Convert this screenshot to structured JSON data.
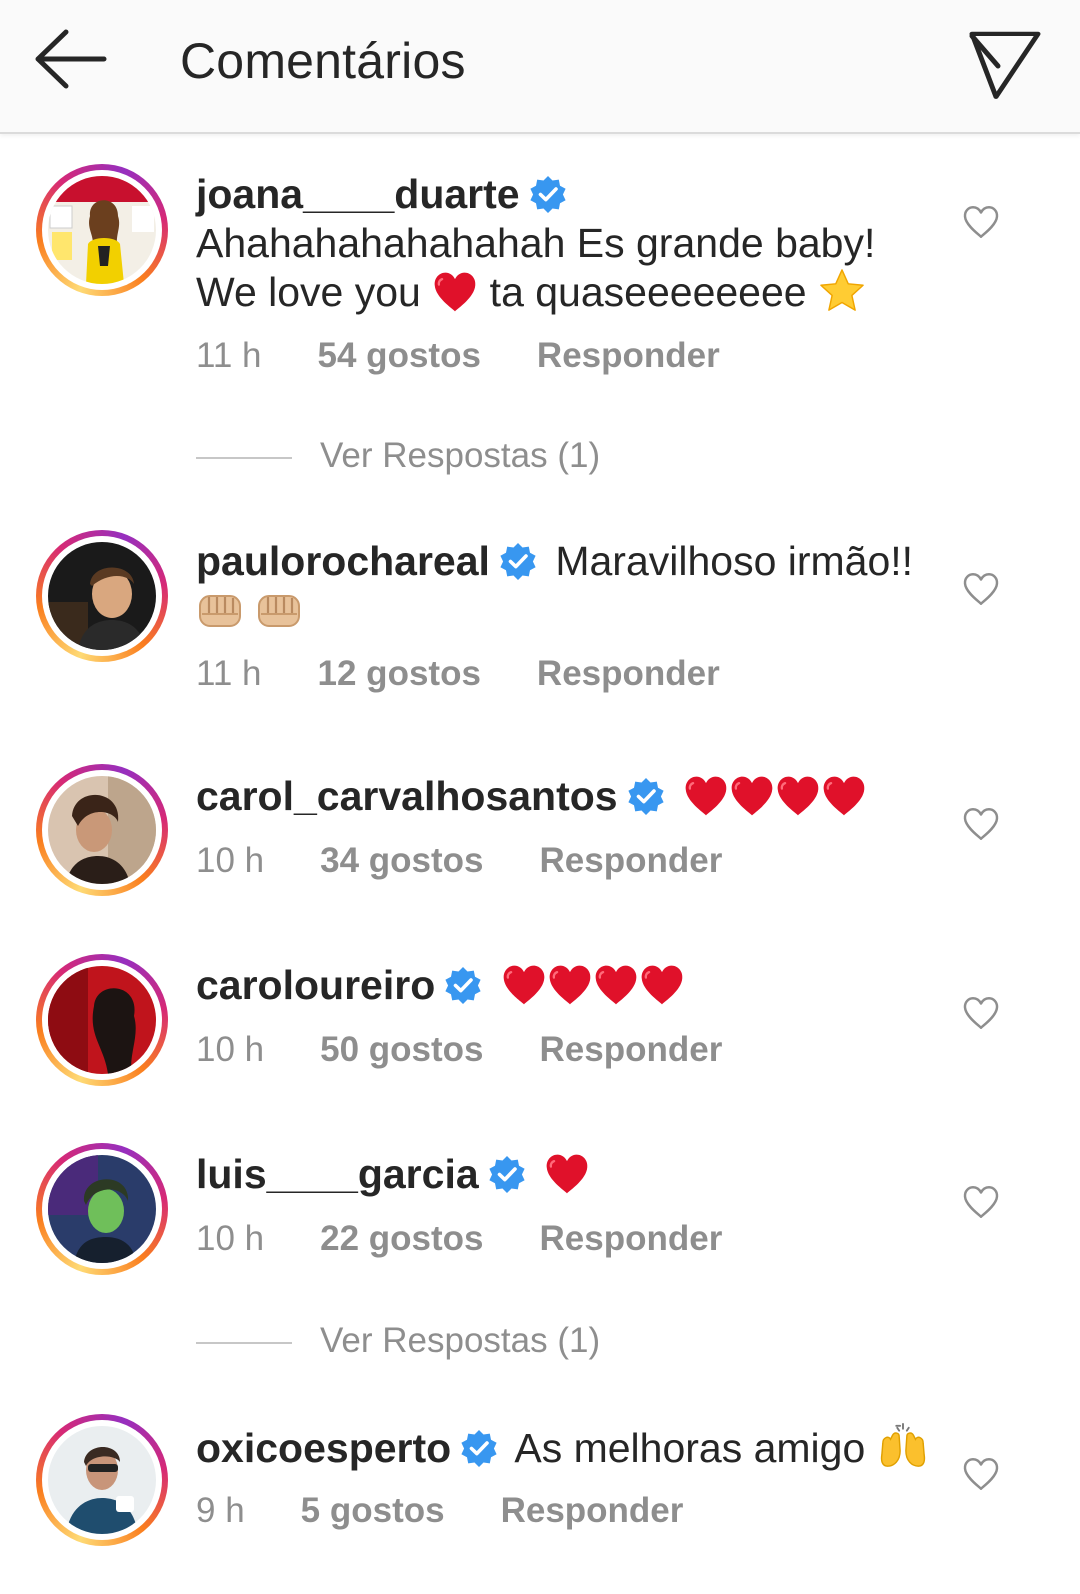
{
  "header": {
    "title": "Comentários",
    "back_icon": "arrow-left-icon",
    "share_icon": "paper-plane-icon"
  },
  "accent": {
    "heart": "#e0112a",
    "verified": "#3897f0",
    "meta_gray": "#8e8e8e"
  },
  "comments": [
    {
      "username": "joana____duarte",
      "verified": true,
      "text_1": "Ahahahahahahahah Es grande baby! We love you",
      "text_2": "ta quaseeeeeeee",
      "emoji": [
        "red-heart",
        "star"
      ],
      "time": "11 h",
      "likes": "54 gostos",
      "reply": "Responder",
      "view_replies": "Ver Respostas (1)"
    },
    {
      "username": "paulorochareal",
      "verified": true,
      "text_1": "Maravilhoso irmão!!",
      "emoji": [
        "fist",
        "fist"
      ],
      "time": "11 h",
      "likes": "12 gostos",
      "reply": "Responder"
    },
    {
      "username": "carol_carvalhosantos",
      "verified": true,
      "emoji": [
        "red-heart",
        "red-heart",
        "red-heart",
        "red-heart"
      ],
      "time": "10 h",
      "likes": "34 gostos",
      "reply": "Responder"
    },
    {
      "username": "caroloureiro",
      "verified": true,
      "emoji": [
        "red-heart",
        "red-heart",
        "red-heart",
        "red-heart"
      ],
      "time": "10 h",
      "likes": "50 gostos",
      "reply": "Responder"
    },
    {
      "username": "luis____garcia",
      "verified": true,
      "emoji": [
        "red-heart"
      ],
      "time": "10 h",
      "likes": "22 gostos",
      "reply": "Responder",
      "view_replies": "Ver Respostas (1)"
    },
    {
      "username": "oxicoesperto",
      "verified": true,
      "text_1": "As melhoras amigo",
      "emoji": [
        "raising-hands"
      ],
      "time": "9 h",
      "likes": "5 gostos",
      "reply": "Responder"
    }
  ]
}
